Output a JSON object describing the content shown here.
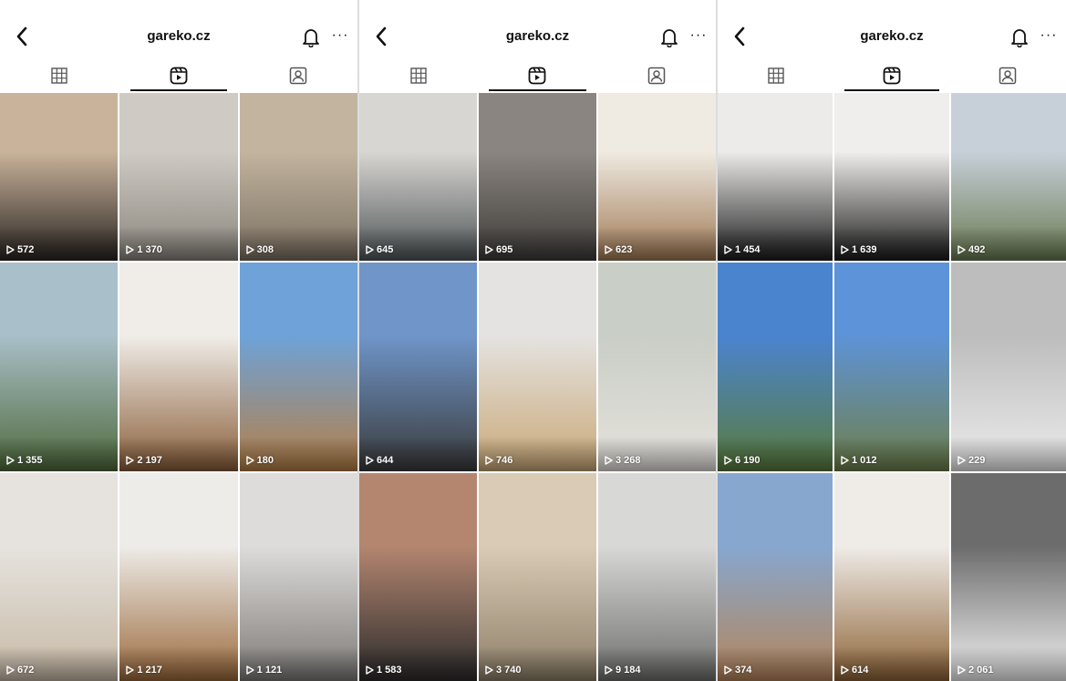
{
  "panels": [
    {
      "title": "gareko.cz",
      "more_label": "···",
      "tabs": [
        "grid-icon",
        "reels-icon",
        "tagged-icon"
      ],
      "active_tab": 1,
      "tiles": [
        {
          "views": "572",
          "colors": [
            "#c9b39a",
            "#2a2522"
          ]
        },
        {
          "views": "1 370",
          "colors": [
            "#cfcac3",
            "#8a857d"
          ]
        },
        {
          "views": "308",
          "colors": [
            "#c2b49e",
            "#7a6f61"
          ]
        },
        {
          "views": "1 355",
          "colors": [
            "#a9bfc9",
            "#4f6a3c"
          ]
        },
        {
          "views": "2 197",
          "colors": [
            "#f0ede8",
            "#8a5f3a"
          ]
        },
        {
          "views": "180",
          "colors": [
            "#6ea2d8",
            "#b57f46"
          ]
        },
        {
          "views": "672",
          "colors": [
            "#e6e3de",
            "#c7b9a6"
          ]
        },
        {
          "views": "1 217",
          "colors": [
            "#eeece9",
            "#9b6a3c"
          ]
        },
        {
          "views": "1 121",
          "colors": [
            "#dedcda",
            "#7d7a77"
          ]
        }
      ]
    },
    {
      "title": "gareko.cz",
      "more_label": "···",
      "tabs": [
        "grid-icon",
        "reels-icon",
        "tagged-icon"
      ],
      "active_tab": 1,
      "tiles": [
        {
          "views": "645",
          "colors": [
            "#d8d6d2",
            "#505558"
          ]
        },
        {
          "views": "695",
          "colors": [
            "#8a8580",
            "#3e3b38"
          ]
        },
        {
          "views": "623",
          "colors": [
            "#efeae2",
            "#a07a55"
          ]
        },
        {
          "views": "644",
          "colors": [
            "#6f95c9",
            "#3a3a3a"
          ]
        },
        {
          "views": "746",
          "colors": [
            "#e4e3e1",
            "#c9a877"
          ]
        },
        {
          "views": "3 268",
          "colors": [
            "#c9cec6",
            "#e5e2dc"
          ]
        },
        {
          "views": "1 583",
          "colors": [
            "#b48670",
            "#2b2b2b"
          ]
        },
        {
          "views": "3 740",
          "colors": [
            "#d9cbb5",
            "#8d7f68"
          ]
        },
        {
          "views": "9 184",
          "colors": [
            "#d8d8d6",
            "#6f706e"
          ]
        }
      ]
    },
    {
      "title": "gareko.cz",
      "more_label": "···",
      "tabs": [
        "grid-icon",
        "reels-icon",
        "tagged-icon"
      ],
      "active_tab": 1,
      "tiles": [
        {
          "views": "1 454",
          "colors": [
            "#ecebea",
            "#1c1c1c"
          ]
        },
        {
          "views": "1 639",
          "colors": [
            "#f0eeec",
            "#1b1b1b"
          ]
        },
        {
          "views": "492",
          "colors": [
            "#c7d0d9",
            "#6a7a52"
          ]
        },
        {
          "views": "6 190",
          "colors": [
            "#4a84cf",
            "#5a7b3c"
          ]
        },
        {
          "views": "1 012",
          "colors": [
            "#5d93d8",
            "#6f7f4a"
          ]
        },
        {
          "views": "229",
          "colors": [
            "#bdbdbd",
            "#ececec"
          ]
        },
        {
          "views": "374",
          "colors": [
            "#87a7cf",
            "#b4855a"
          ]
        },
        {
          "views": "614",
          "colors": [
            "#efece8",
            "#8e6437"
          ]
        },
        {
          "views": "2 061",
          "colors": [
            "#6c6c6c",
            "#f2f2f2"
          ]
        }
      ]
    }
  ]
}
